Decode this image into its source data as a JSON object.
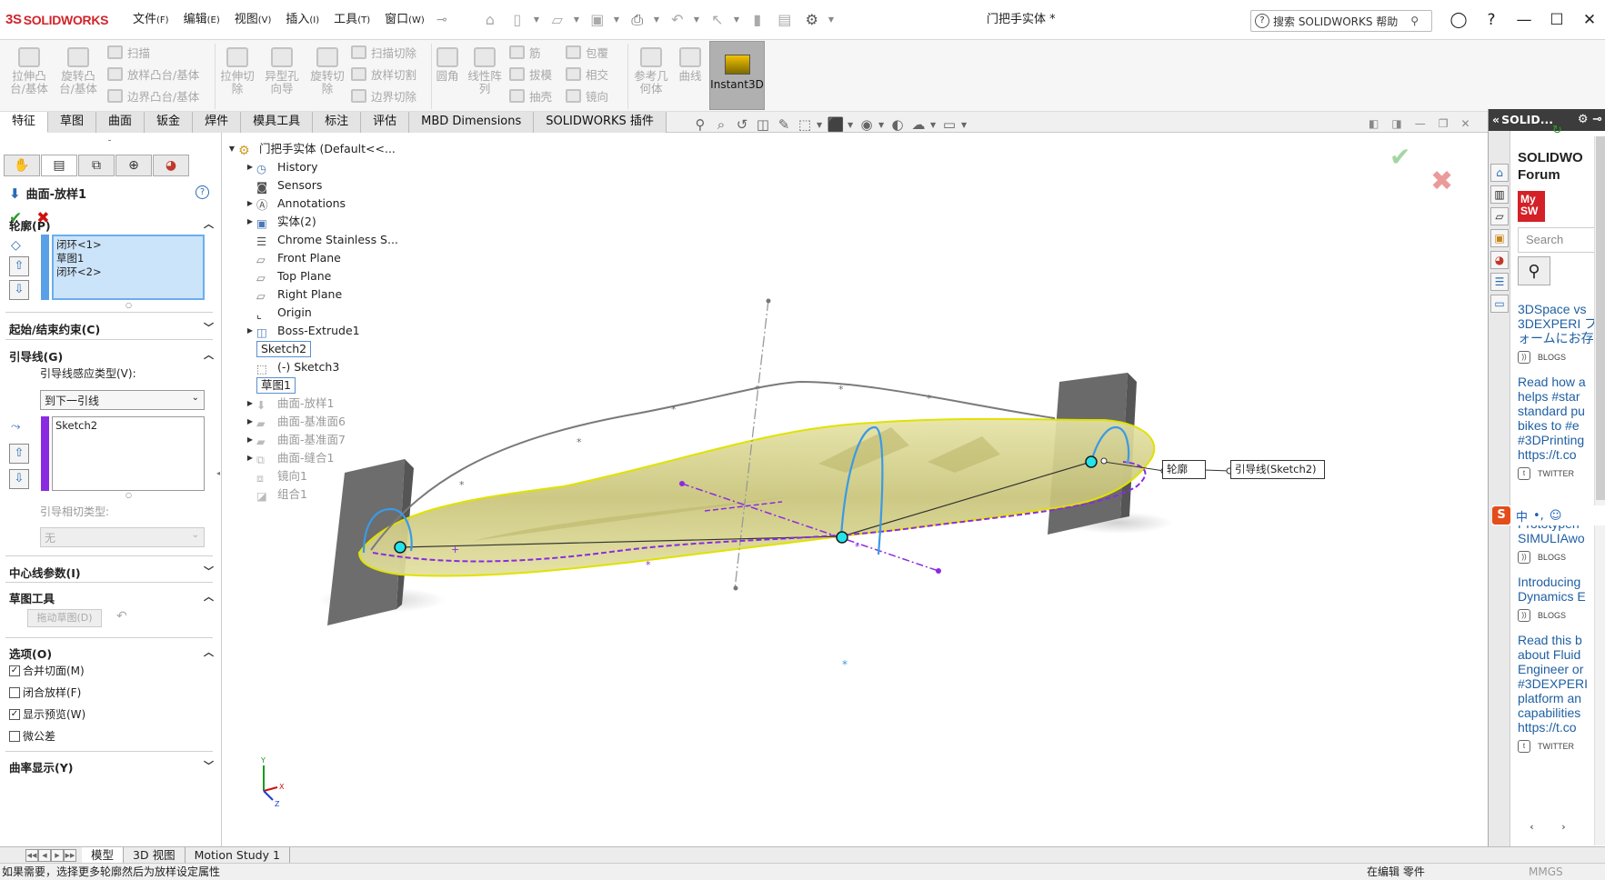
{
  "app": {
    "brand_prefix": "3S",
    "brand": "SOLIDWORKS",
    "doc_title": "门把手实体 *"
  },
  "menus": [
    {
      "label": "文件",
      "key": "(F)"
    },
    {
      "label": "编辑",
      "key": "(E)"
    },
    {
      "label": "视图",
      "key": "(V)"
    },
    {
      "label": "插入",
      "key": "(I)"
    },
    {
      "label": "工具",
      "key": "(T)"
    },
    {
      "label": "窗口",
      "key": "(W)"
    }
  ],
  "search": {
    "placeholder": "搜索 SOLIDWORKS 帮助"
  },
  "ribbon": {
    "extrude_boss": "拉伸凸\n台/基体",
    "revolve_boss": "旋转凸\n台/基体",
    "sweep": "扫描",
    "loft_boss": "放样凸台/基体",
    "boundary_boss": "边界凸台/基体",
    "extrude_cut": "拉伸切\n除",
    "hole_wizard": "异型孔\n向导",
    "revolve_cut": "旋转切\n除",
    "swept_cut": "扫描切除",
    "lofted_cut": "放样切割",
    "boundary_cut": "边界切除",
    "fillet": "圆角",
    "linear_pattern": "线性阵\n列",
    "rib": "筋",
    "draft": "拔模",
    "shell": "抽壳",
    "wrap": "包覆",
    "intersect": "相交",
    "mirror": "镜向",
    "ref_geometry": "参考几\n何体",
    "curves": "曲线",
    "instant3d": "Instant3D"
  },
  "command_tabs": [
    "特征",
    "草图",
    "曲面",
    "钣金",
    "焊件",
    "模具工具",
    "标注",
    "评估",
    "MBD Dimensions",
    "SOLIDWORKS 插件"
  ],
  "property_manager": {
    "feature_name": "曲面-放样1",
    "profile_section": "轮廓(P)",
    "profiles": [
      "闭环<1>",
      "草图1",
      "闭环<2>"
    ],
    "start_end_section": "起始/结束约束(C)",
    "guide_section": "引导线(G)",
    "guide_influence_label": "引导线感应类型(V):",
    "guide_influence_value": "到下一引线",
    "guides": [
      "Sketch2"
    ],
    "guide_tangency_label": "引导相切类型:",
    "guide_tangency_value": "无",
    "centerline_section": "中心线参数(I)",
    "sketch_tools_section": "草图工具",
    "drag_sketch_button": "拖动草图(D)",
    "options_section": "选项(O)",
    "options": [
      {
        "label": "合并切面(M)",
        "checked": true
      },
      {
        "label": "闭合放样(F)",
        "checked": false
      },
      {
        "label": "显示预览(W)",
        "checked": true
      },
      {
        "label": "微公差",
        "checked": false
      }
    ],
    "curvature_section": "曲率显示(Y)"
  },
  "tree": {
    "root": "门把手实体  (Default<<...",
    "items": [
      {
        "label": "History"
      },
      {
        "label": "Sensors"
      },
      {
        "label": "Annotations"
      },
      {
        "label": "实体(2)"
      },
      {
        "label": "Chrome Stainless S..."
      },
      {
        "label": "Front Plane"
      },
      {
        "label": "Top Plane"
      },
      {
        "label": "Right Plane"
      },
      {
        "label": "Origin"
      },
      {
        "label": "Boss-Extrude1"
      },
      {
        "label": "Sketch2"
      },
      {
        "label": "(-) Sketch3"
      },
      {
        "label": "草图1"
      },
      {
        "label": "曲面-放样1"
      },
      {
        "label": "曲面-基准面6"
      },
      {
        "label": "曲面-基准面7"
      },
      {
        "label": "曲面-缝合1"
      },
      {
        "label": "镜向1"
      },
      {
        "label": "组合1"
      }
    ]
  },
  "viewport": {
    "callout_profile": "轮廓",
    "callout_guide": "引导线(Sketch2)"
  },
  "task_pane": {
    "header": "SOLID...",
    "forum_title": "SOLIDWO Forum",
    "mysw": "My SW",
    "search_placeholder": "Search",
    "feeds": [
      {
        "text": "3DSpace vs 3DEXPERI フォームにお存",
        "tag": "BLOGS"
      },
      {
        "text": "Read how a helps #star standard pu bikes to #e #3DPrinting https://t.co",
        "tag": "TWITTER"
      },
      {
        "text": "Prototypen SIMULIAwo",
        "tag": "BLOGS"
      },
      {
        "text": "Introducing Dynamics E",
        "tag": "BLOGS"
      },
      {
        "text": "Read this b about Fluid Engineer or #3DEXPERI platform an capabilities https://t.co",
        "tag": "TWITTER"
      }
    ],
    "ime_label": "中"
  },
  "bottom_tabs": [
    "模型",
    "3D 视图",
    "Motion Study 1"
  ],
  "status": {
    "left": "如果需要，选择更多轮廓然后为放样设定属性",
    "mode": "在编辑 零件",
    "units": "MMGS"
  }
}
